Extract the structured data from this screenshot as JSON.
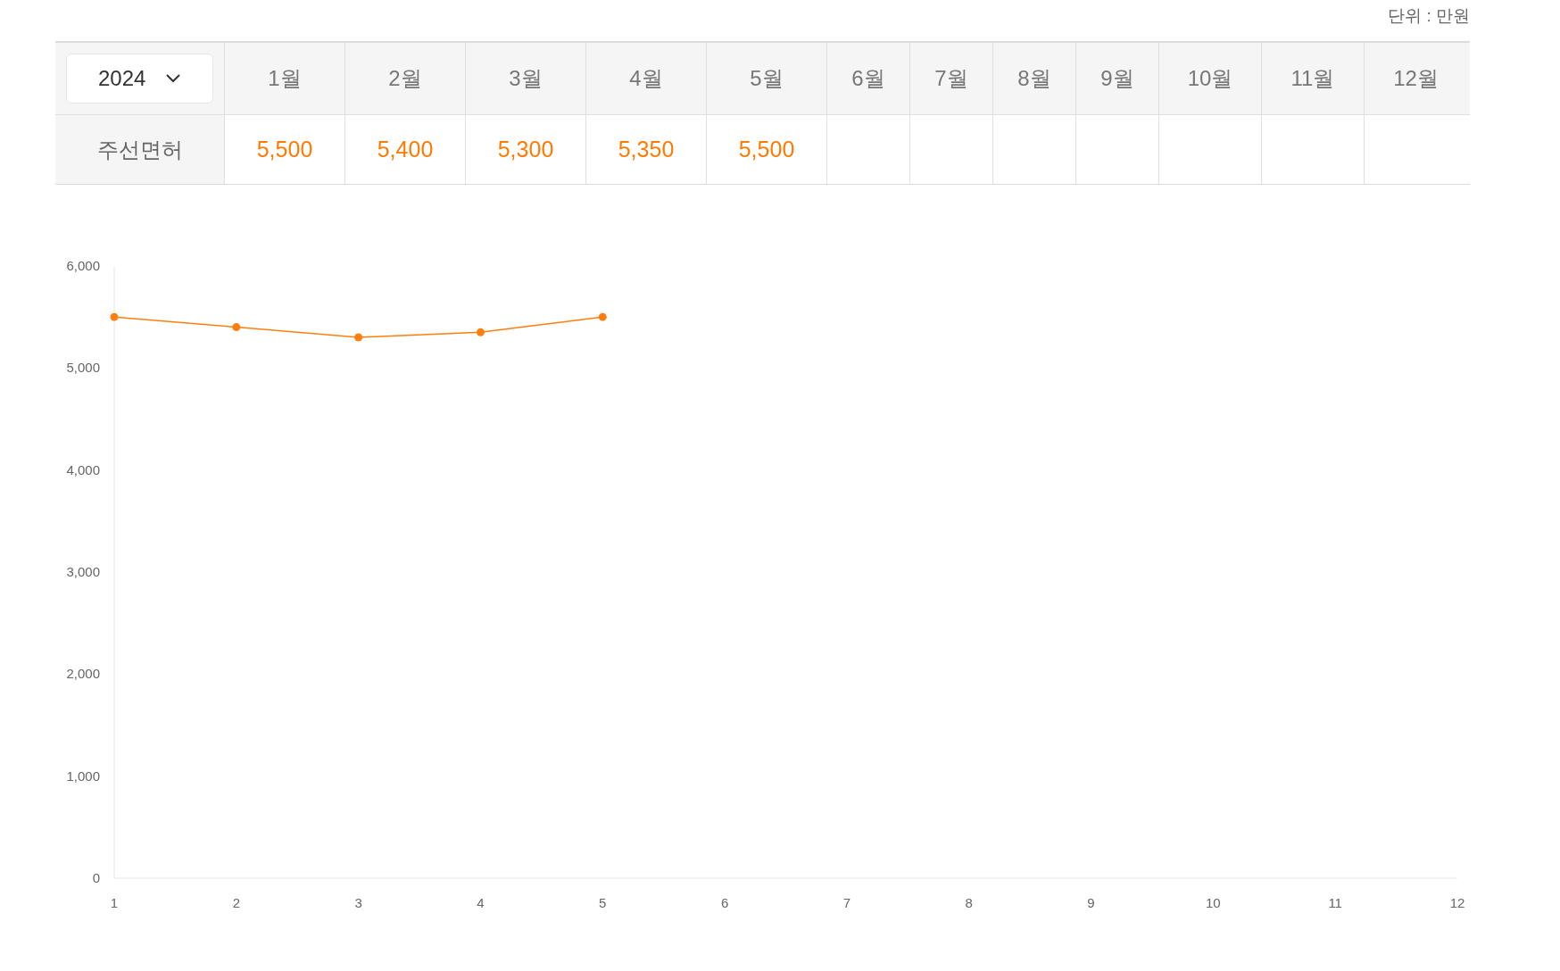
{
  "unit_label": "단위 : 만원",
  "table": {
    "year_select": {
      "value": "2024"
    },
    "columns": [
      "1월",
      "2월",
      "3월",
      "4월",
      "5월",
      "6월",
      "7월",
      "8월",
      "9월",
      "10월",
      "11월",
      "12월"
    ],
    "rows": [
      {
        "label": "주선면허",
        "cells": [
          "5,500",
          "5,400",
          "5,300",
          "5,350",
          "5,500"
        ]
      }
    ]
  },
  "chart_data": {
    "type": "line",
    "categories": [
      "1",
      "2",
      "3",
      "4",
      "5",
      "6",
      "7",
      "8",
      "9",
      "10",
      "11",
      "12"
    ],
    "series": [
      {
        "color": "#ff7f0e",
        "marker": "circle",
        "values": [
          5500,
          5400,
          5300,
          5350,
          5500,
          null,
          null,
          null,
          null,
          null,
          null,
          null
        ]
      }
    ],
    "ylim": [
      0,
      6000
    ],
    "yticks": [
      {
        "value": 0,
        "label": "0"
      },
      {
        "value": 1000,
        "label": "1,000"
      },
      {
        "value": 2000,
        "label": "2,000"
      },
      {
        "value": 3000,
        "label": "3,000"
      },
      {
        "value": 4000,
        "label": "4,000"
      },
      {
        "value": 5000,
        "label": "5,000"
      },
      {
        "value": 6000,
        "label": "6,000"
      }
    ]
  }
}
